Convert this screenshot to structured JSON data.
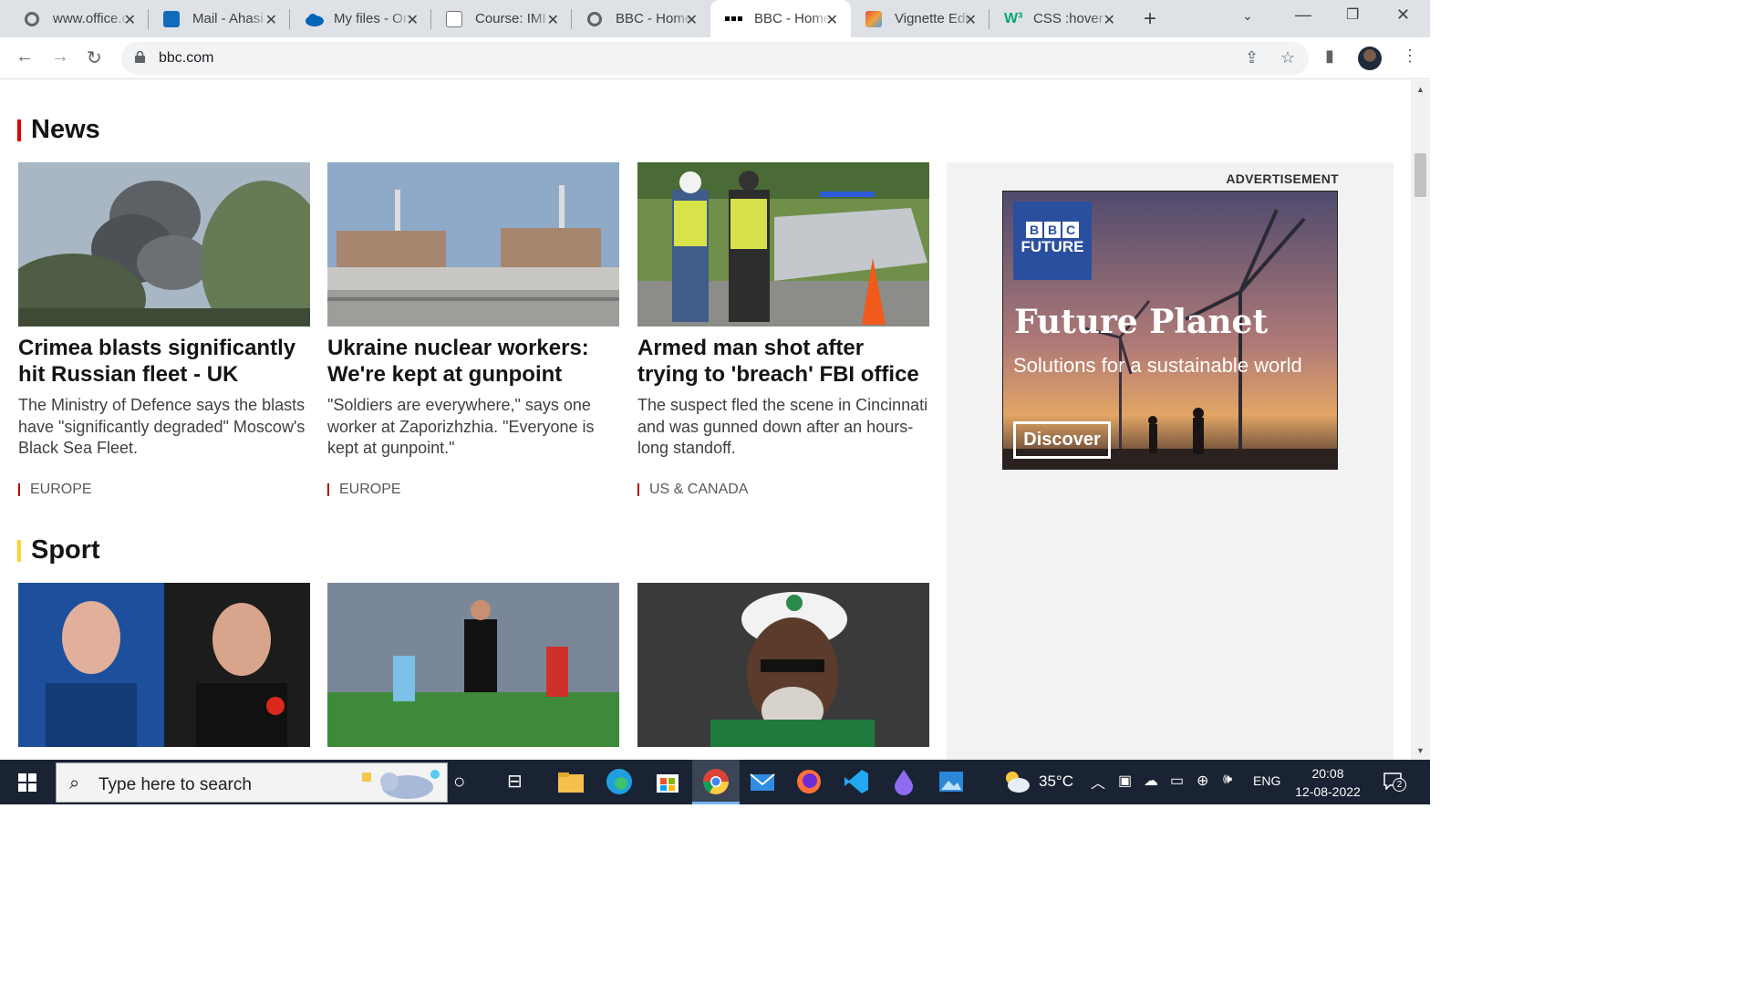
{
  "browser": {
    "tabs": [
      {
        "title": "www.office.com",
        "active": false
      },
      {
        "title": "Mail - Ahasi",
        "active": false
      },
      {
        "title": "My files - OneDrive",
        "active": false
      },
      {
        "title": "Course: IMI",
        "active": false
      },
      {
        "title": "BBC - Home",
        "active": false
      },
      {
        "title": "BBC - Home",
        "active": true
      },
      {
        "title": "Vignette Editor",
        "active": false
      },
      {
        "title": "CSS :hover",
        "active": false
      }
    ],
    "url": "bbc.com"
  },
  "page": {
    "news": {
      "title": "News",
      "accent": "#e10000",
      "articles": [
        {
          "headline": "Crimea blasts significantly hit Russian fleet - UK",
          "summary": "The Ministry of Defence says the blasts have \"significantly degraded\" Moscow's Black Sea Fleet.",
          "tag": "EUROPE"
        },
        {
          "headline": "Ukraine nuclear workers: We're kept at gunpoint",
          "summary": "\"Soldiers are everywhere,\" says one worker at Zaporizhzhia. \"Everyone is kept at gunpoint.\"",
          "tag": "EUROPE"
        },
        {
          "headline": "Armed man shot after trying to 'breach' FBI office",
          "summary": "The suspect fled the scene in Cincinnati and was gunned down after an hours-long standoff.",
          "tag": "US & CANADA"
        }
      ]
    },
    "sport": {
      "title": "Sport",
      "accent": "#ffd230"
    },
    "advertisement": {
      "label": "ADVERTISEMENT",
      "logo_line": "FUTURE",
      "logo_letters": [
        "B",
        "B",
        "C"
      ],
      "headline": "Future Planet",
      "subheadline": "Solutions for a sustainable world",
      "cta": "Discover"
    }
  },
  "taskbar": {
    "search_placeholder": "Type here to search",
    "weather": "35°C",
    "language": "ENG",
    "time": "20:08",
    "date": "12-08-2022",
    "notifications": "2"
  }
}
